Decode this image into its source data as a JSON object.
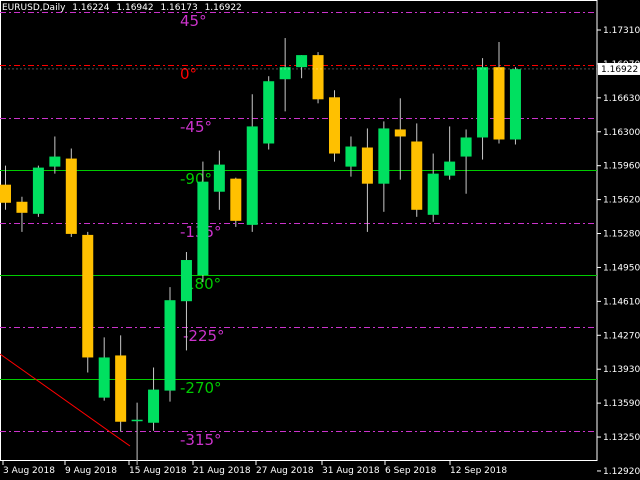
{
  "header": {
    "symbol_timeframe": "EURUSD,Daily",
    "open": "1.16224",
    "high": "1.16942",
    "low": "1.16173",
    "close": "1.16922"
  },
  "colors": {
    "background": "#000000",
    "foreground": "#ffffff",
    "bull_candle": "#00e060",
    "bear_candle": "#ffc000",
    "wick": "#c8c8c8",
    "gann_green": "#00cc00",
    "gann_magenta": "#cc33cc",
    "gann_red": "#ff0000",
    "diagonal": "#ff0000",
    "price_label_bg": "#ffffff"
  },
  "price_axis": {
    "min": 1.128,
    "max": 1.176,
    "ticks": [
      "1.17310",
      "1.16970",
      "1.16630",
      "1.16300",
      "1.15960",
      "1.15620",
      "1.15280",
      "1.14950",
      "1.14610",
      "1.14270",
      "1.13930",
      "1.13590",
      "1.13250",
      "1.12920"
    ],
    "current_price_label": "1.16922"
  },
  "time_axis": {
    "labels": [
      "3 Aug 2018",
      "9 Aug 2018",
      "15 Aug 2018",
      "21 Aug 2018",
      "27 Aug 2018",
      "31 Aug 2018",
      "6 Sep 2018",
      "12 Sep 2018"
    ]
  },
  "gann_levels": [
    {
      "label": "45°",
      "color": "magenta",
      "style": "dashed"
    },
    {
      "label": "0°",
      "color": "red",
      "style": "dashed"
    },
    {
      "label": "-45°",
      "color": "magenta",
      "style": "dashed"
    },
    {
      "label": "-90°",
      "color": "green",
      "style": "solid"
    },
    {
      "label": "-135°",
      "color": "magenta",
      "style": "dashed"
    },
    {
      "label": "180°",
      "color": "green",
      "style": "solid"
    },
    {
      "label": "-225°",
      "color": "magenta",
      "style": "dashed"
    },
    {
      "label": "-270°",
      "color": "green",
      "style": "solid"
    },
    {
      "label": "-315°",
      "color": "magenta",
      "style": "dashed"
    }
  ],
  "chart_data": {
    "type": "candlestick",
    "candles": [
      {
        "o": 1.1577,
        "h": 1.1596,
        "l": 1.1552,
        "c": 1.1559
      },
      {
        "o": 1.156,
        "h": 1.1565,
        "l": 1.153,
        "c": 1.1549
      },
      {
        "o": 1.1548,
        "h": 1.1596,
        "l": 1.1545,
        "c": 1.1594
      },
      {
        "o": 1.1595,
        "h": 1.1625,
        "l": 1.1588,
        "c": 1.1605
      },
      {
        "o": 1.1603,
        "h": 1.1613,
        "l": 1.1525,
        "c": 1.1528
      },
      {
        "o": 1.1527,
        "h": 1.153,
        "l": 1.139,
        "c": 1.1405
      },
      {
        "o": 1.1365,
        "h": 1.1425,
        "l": 1.1362,
        "c": 1.1405
      },
      {
        "o": 1.1407,
        "h": 1.1427,
        "l": 1.1331,
        "c": 1.1341
      },
      {
        "o": 1.1343,
        "h": 1.136,
        "l": 1.1298,
        "c": 1.1343
      },
      {
        "o": 1.134,
        "h": 1.1395,
        "l": 1.1332,
        "c": 1.1373
      },
      {
        "o": 1.1372,
        "h": 1.1475,
        "l": 1.1361,
        "c": 1.1462
      },
      {
        "o": 1.1461,
        "h": 1.151,
        "l": 1.1412,
        "c": 1.1502
      },
      {
        "o": 1.1487,
        "h": 1.16,
        "l": 1.148,
        "c": 1.158
      },
      {
        "o": 1.157,
        "h": 1.1611,
        "l": 1.1552,
        "c": 1.1597
      },
      {
        "o": 1.1583,
        "h": 1.1584,
        "l": 1.1535,
        "c": 1.1541
      },
      {
        "o": 1.1537,
        "h": 1.1667,
        "l": 1.153,
        "c": 1.1635
      },
      {
        "o": 1.1618,
        "h": 1.1685,
        "l": 1.1612,
        "c": 1.168
      },
      {
        "o": 1.1682,
        "h": 1.1723,
        "l": 1.165,
        "c": 1.1694
      },
      {
        "o": 1.1694,
        "h": 1.1706,
        "l": 1.1683,
        "c": 1.1706
      },
      {
        "o": 1.1706,
        "h": 1.1709,
        "l": 1.1658,
        "c": 1.1662
      },
      {
        "o": 1.1664,
        "h": 1.1671,
        "l": 1.16,
        "c": 1.1608
      },
      {
        "o": 1.1595,
        "h": 1.1625,
        "l": 1.1585,
        "c": 1.1615
      },
      {
        "o": 1.1614,
        "h": 1.1633,
        "l": 1.153,
        "c": 1.1578
      },
      {
        "o": 1.1578,
        "h": 1.164,
        "l": 1.155,
        "c": 1.1633
      },
      {
        "o": 1.1632,
        "h": 1.1663,
        "l": 1.1582,
        "c": 1.1625
      },
      {
        "o": 1.162,
        "h": 1.1638,
        "l": 1.1545,
        "c": 1.1552
      },
      {
        "o": 1.1547,
        "h": 1.1608,
        "l": 1.154,
        "c": 1.1588
      },
      {
        "o": 1.1586,
        "h": 1.1635,
        "l": 1.1582,
        "c": 1.16
      },
      {
        "o": 1.1605,
        "h": 1.1632,
        "l": 1.1568,
        "c": 1.1624
      },
      {
        "o": 1.1624,
        "h": 1.1703,
        "l": 1.1602,
        "c": 1.1694
      },
      {
        "o": 1.1694,
        "h": 1.1719,
        "l": 1.1618,
        "c": 1.1622
      },
      {
        "o": 1.1622,
        "h": 1.1694,
        "l": 1.1617,
        "c": 1.1692
      }
    ]
  }
}
